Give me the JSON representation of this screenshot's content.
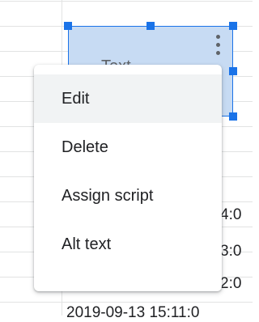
{
  "sheet": {
    "drawing_label": "Text",
    "visible_cells": [
      {
        "text": "4:0"
      },
      {
        "text": "3:0"
      },
      {
        "text": "2:0"
      },
      {
        "text": "2019-09-13 15:11:0"
      }
    ]
  },
  "context_menu": {
    "items": [
      {
        "label": "Edit"
      },
      {
        "label": "Delete"
      },
      {
        "label": "Assign script"
      },
      {
        "label": "Alt text"
      }
    ]
  },
  "colors": {
    "selection": "#1a73e8",
    "drawing_fill": "#c7dbf3",
    "hover": "#f1f3f4"
  }
}
